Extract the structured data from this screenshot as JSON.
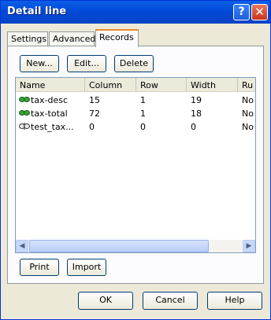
{
  "window": {
    "title": "Detail line"
  },
  "tabs": [
    {
      "label": "Settings"
    },
    {
      "label": "Advanced"
    },
    {
      "label": "Records"
    }
  ],
  "toolbar": {
    "new_label": "New...",
    "edit_label": "Edit...",
    "delete_label": "Delete"
  },
  "list": {
    "columns": [
      "Name",
      "Column",
      "Row",
      "Width",
      "Ru"
    ],
    "rows": [
      {
        "icon": "linked-icon",
        "name": "tax-desc",
        "column": "15",
        "row": "1",
        "width": "19",
        "ru": "No"
      },
      {
        "icon": "linked-icon",
        "name": "tax-total",
        "column": "72",
        "row": "1",
        "width": "18",
        "ru": "No"
      },
      {
        "icon": "unlinked-icon",
        "name": "test_tax...",
        "column": "0",
        "row": "0",
        "width": "0",
        "ru": "No"
      }
    ]
  },
  "actions": {
    "print_label": "Print",
    "import_label": "Import"
  },
  "footer": {
    "ok_label": "OK",
    "cancel_label": "Cancel",
    "help_label": "Help"
  }
}
